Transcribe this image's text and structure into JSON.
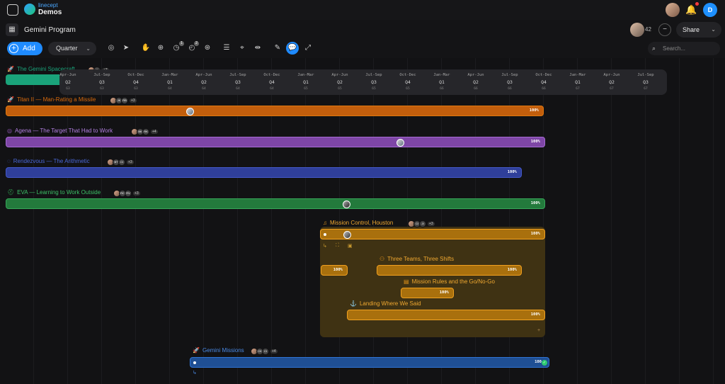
{
  "app": {
    "brand_top": "linecept",
    "brand_name": "Demos",
    "program_title": "Gemini Program"
  },
  "header": {
    "collaborator_count": "42",
    "share_label": "Share",
    "user_initial": "D"
  },
  "toolbar": {
    "add_label": "Add",
    "zoom_value": "Quarter",
    "search_placeholder": "Search...",
    "badge_a": "1",
    "badge_b": "2"
  },
  "timeline": [
    {
      "months": "Apr-Jun",
      "quarter": "Q2",
      "year": "63"
    },
    {
      "months": "Jul-Sep",
      "quarter": "Q3",
      "year": "63"
    },
    {
      "months": "Oct-Dec",
      "quarter": "Q4",
      "year": "63"
    },
    {
      "months": "Jan-Mar",
      "quarter": "Q1",
      "year": "64"
    },
    {
      "months": "Apr-Jun",
      "quarter": "Q2",
      "year": "64"
    },
    {
      "months": "Jul-Sep",
      "quarter": "Q3",
      "year": "64"
    },
    {
      "months": "Oct-Dec",
      "quarter": "Q4",
      "year": "64"
    },
    {
      "months": "Jan-Mar",
      "quarter": "Q1",
      "year": "65"
    },
    {
      "months": "Apr-Jun",
      "quarter": "Q2",
      "year": "65"
    },
    {
      "months": "Jul-Sep",
      "quarter": "Q3",
      "year": "65"
    },
    {
      "months": "Oct-Dec",
      "quarter": "Q4",
      "year": "65"
    },
    {
      "months": "Jan-Mar",
      "quarter": "Q1",
      "year": "66"
    },
    {
      "months": "Apr-Jun",
      "quarter": "Q2",
      "year": "66"
    },
    {
      "months": "Jul-Sep",
      "quarter": "Q3",
      "year": "66"
    },
    {
      "months": "Oct-Dec",
      "quarter": "Q4",
      "year": "66"
    },
    {
      "months": "Jan-Mar",
      "quarter": "Q1",
      "year": "67"
    },
    {
      "months": "Apr-Jun",
      "quarter": "Q2",
      "year": "67"
    },
    {
      "months": "Jul-Sep",
      "quarter": "Q3",
      "year": "67"
    }
  ],
  "rows": {
    "spacecraft": {
      "title": "The Gemini Spacecraft",
      "more": "+3",
      "color": "#1aa37a"
    },
    "titan": {
      "title": "Titan II — Man-Rating a Missile",
      "more": "+3",
      "progress": "100%",
      "color": "#d96a0c"
    },
    "agena": {
      "title": "Agena — The Target That Had to Work",
      "more": "+4",
      "progress": "100%",
      "color": "#9b5cc4"
    },
    "rendezvous": {
      "title": "Rendezvous — The Arithmetic",
      "more": "+3",
      "progress": "100%",
      "color": "#3a55b8"
    },
    "eva": {
      "title": "EVA — Learning to Work Outside",
      "more": "+3",
      "progress": "100%",
      "color": "#2f9e4f"
    },
    "mission_control": {
      "title": "Mission Control, Houston",
      "more": "+3",
      "progress": "100%",
      "color": "#e0931a",
      "children": {
        "unnamed": {
          "progress": "100%"
        },
        "three_teams": {
          "title": "Three Teams, Three Shifts",
          "progress": "100%"
        },
        "mission_rules": {
          "title": "Mission Rules and the Go/No-Go",
          "progress": "100%"
        },
        "landing": {
          "title": "Landing Where We Said",
          "progress": "100%"
        }
      }
    },
    "missions": {
      "title": "Gemini Missions",
      "more": "+4",
      "progress": "100",
      "color": "#2e6ec9"
    }
  }
}
